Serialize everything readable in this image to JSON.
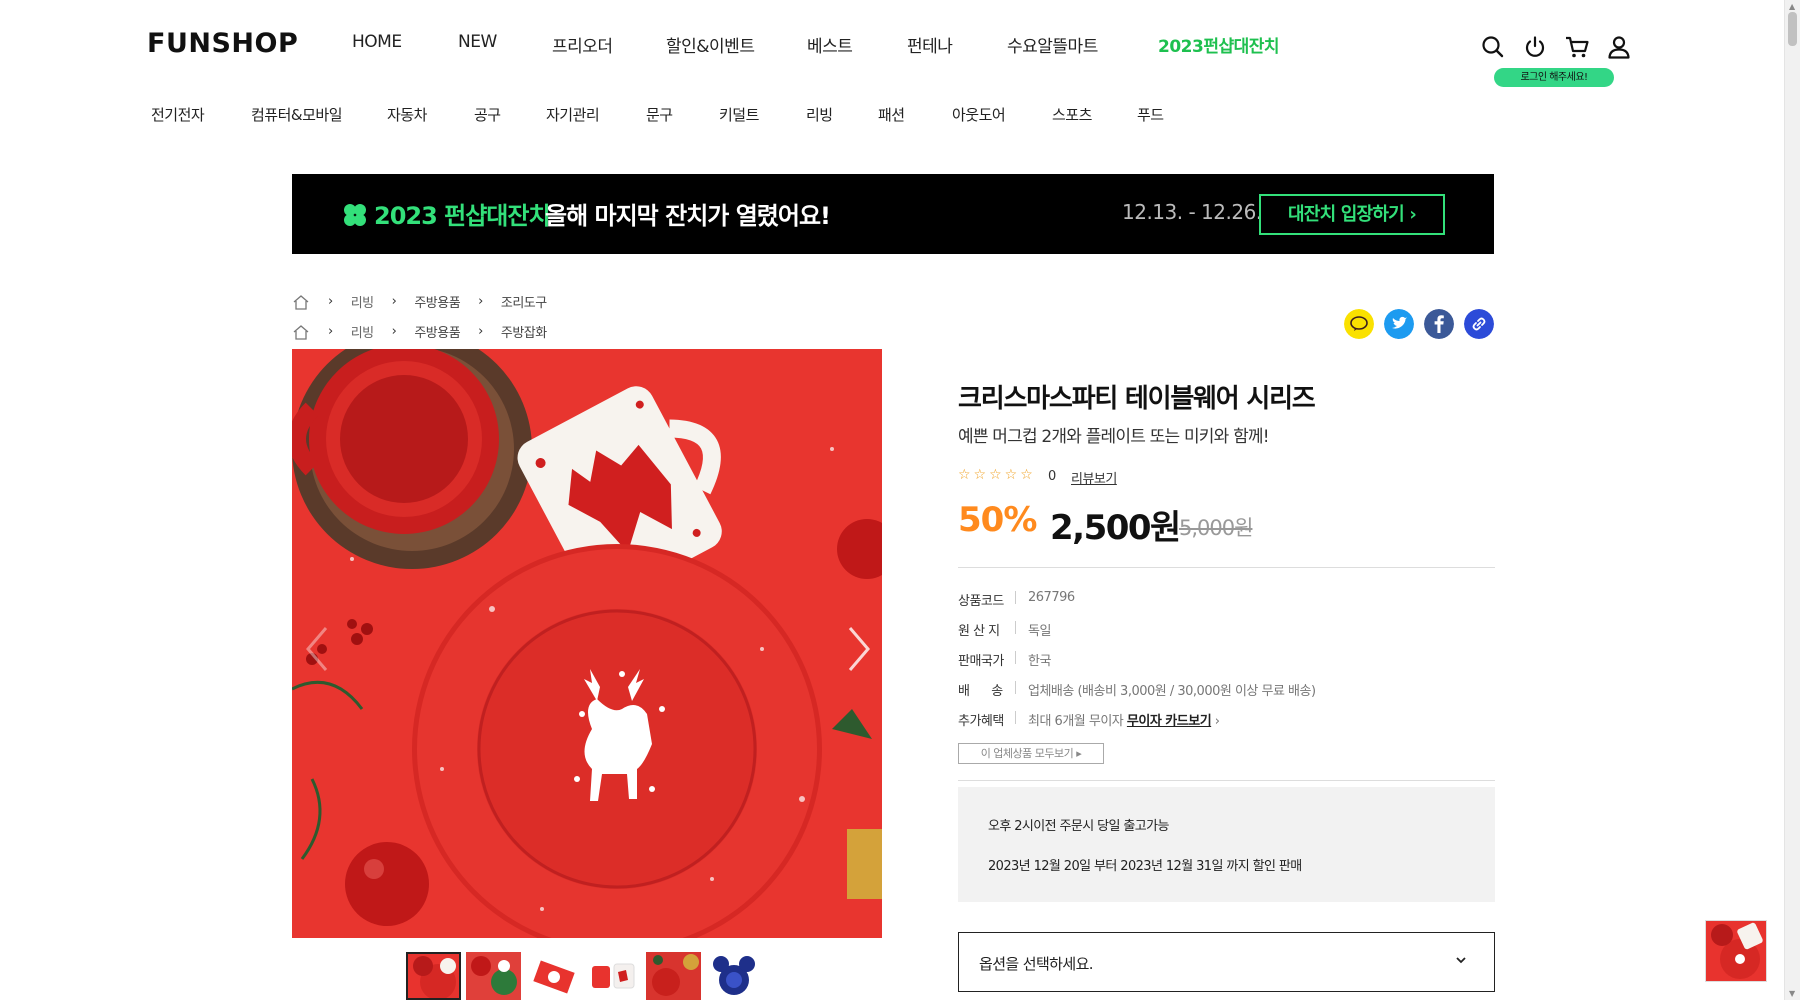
{
  "header": {
    "logo": "FUNSHOP",
    "gnb": [
      "HOME",
      "NEW",
      "프리오더",
      "할인&이벤트",
      "베스트",
      "펀테나",
      "수요알뜰마트",
      "2023펀샵대잔치"
    ],
    "login_hint": "로그인 해주세요!",
    "icons": [
      "search-icon",
      "power-icon",
      "cart-icon",
      "user-icon"
    ]
  },
  "categories": [
    "전기전자",
    "컴퓨터&모바일",
    "자동차",
    "공구",
    "자기관리",
    "문구",
    "키덜트",
    "리빙",
    "패션",
    "아웃도어",
    "스포츠",
    "푸드"
  ],
  "banner": {
    "title": "2023 펀샵대잔치",
    "subtitle": "올해 마지막 잔치가 열렸어요!",
    "date": "12.13. - 12.26.",
    "button": "대잔치 입장하기"
  },
  "breadcrumbs": [
    [
      "리빙",
      "주방용품",
      "조리도구"
    ],
    [
      "리빙",
      "주방용품",
      "주방잡화"
    ]
  ],
  "share_icons": [
    "kakaotalk-icon",
    "twitter-icon",
    "facebook-icon",
    "link-icon"
  ],
  "product": {
    "name": "크리스마스파티 테이블웨어 시리즈",
    "description": "예쁜 머그컵 2개와 플레이트 또는 미키와 함께!",
    "rating_stars": "☆☆☆☆☆",
    "review_count": "0",
    "review_link": "리뷰보기",
    "discount": "50%",
    "price": "2,500원",
    "original_price": "5,000원",
    "info": [
      {
        "key": "상품코드",
        "value": "267796"
      },
      {
        "key": "원 산 지",
        "value": "독일"
      },
      {
        "key": "판매국가",
        "value": "한국"
      },
      {
        "key": "배      송",
        "value": "업체배송 (배송비 3,000원 / 30,000원 이상 무료 배송)"
      },
      {
        "key": "추가혜택",
        "value": "최대 6개월 무이자",
        "link": "무이자 카드보기"
      }
    ],
    "all_products_button": "이 업체상품 모두보기",
    "shipping_notes": [
      "오후 2시이전 주문시 당일 출고가능",
      "2023년 12월 20일 부터 2023년 12월 31일 까지 할인 판매"
    ],
    "option_placeholder": "옵션을 선택하세요."
  },
  "colors": {
    "accent_green": "#1ec04f",
    "banner_green": "#33e07a",
    "discount_orange": "#ff8a1e",
    "product_red": "#e8332e"
  }
}
